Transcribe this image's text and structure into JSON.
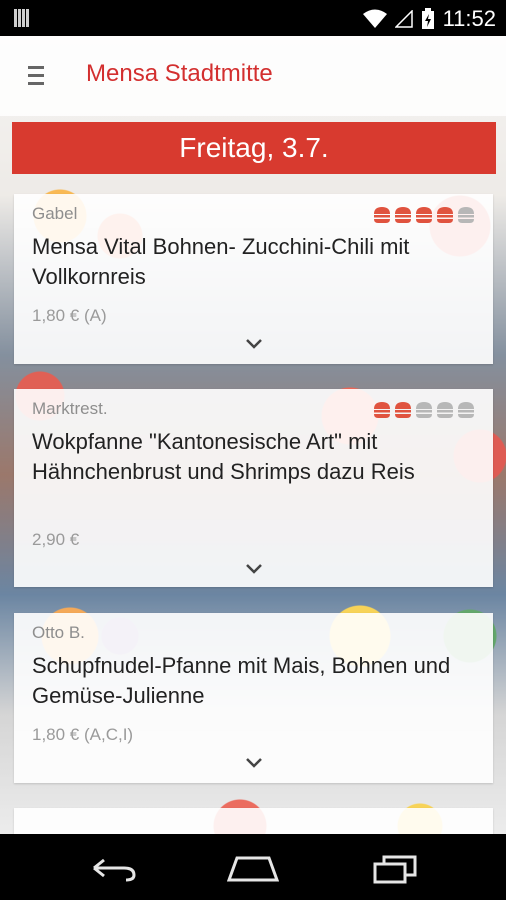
{
  "status": {
    "time": "11:52"
  },
  "app": {
    "title": "Mensa Stadtmitte"
  },
  "date_header": "Freitag, 3.7.",
  "meals": [
    {
      "location": "Gabel",
      "title": "Mensa Vital Bohnen- Zucchini-Chili mit Vollkornreis",
      "price": "1,80 € (A)",
      "rating": {
        "filled": 4,
        "total": 5
      }
    },
    {
      "location": "Marktrest.",
      "title": "Wokpfanne \"Kantonesische Art\" mit Hähnchenbrust und Shrimps dazu Reis",
      "price": "2,90 €",
      "rating": {
        "filled": 2,
        "total": 5
      }
    },
    {
      "location": "Otto B.",
      "title": "Schupfnudel-Pfanne mit Mais, Bohnen und Gemüse-Julienne",
      "price": "1,80 € (A,C,I)"
    }
  ],
  "colors": {
    "accent": "#d32f2f",
    "header_bg": "#d83a2f",
    "rating_filled": "#e0533f",
    "rating_empty": "#b7b7b7"
  },
  "icons": {
    "menu": "menu-icon",
    "expand": "chevron-down-icon",
    "rating": "burger-icon",
    "back": "back-icon",
    "home": "home-icon",
    "recents": "recents-icon"
  }
}
